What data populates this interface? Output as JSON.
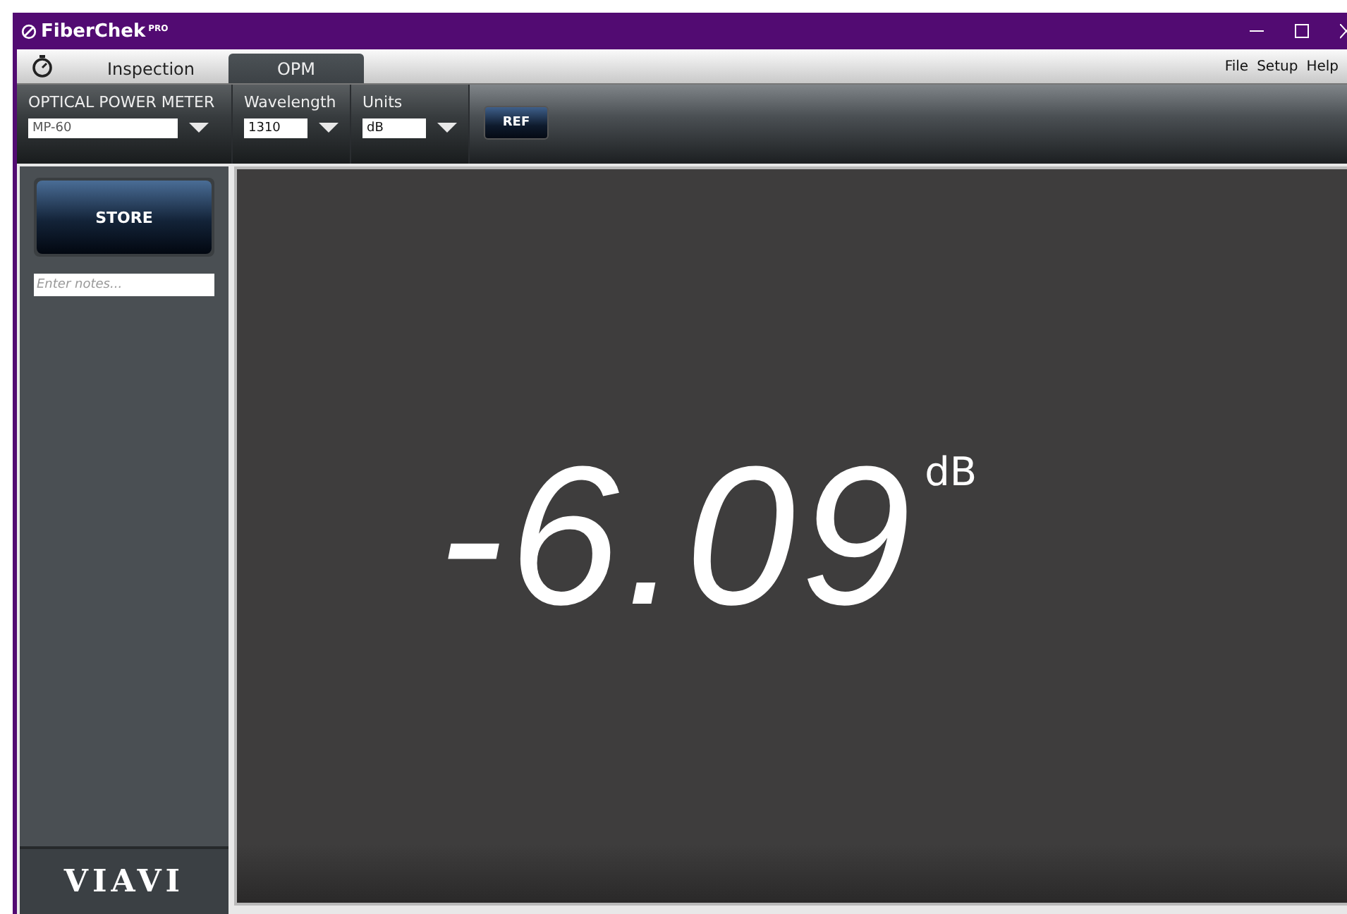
{
  "window": {
    "title": "FiberChek",
    "title_suffix": "PRO"
  },
  "tabs": [
    {
      "label": "Inspection",
      "selected": false
    },
    {
      "label": "OPM",
      "selected": true
    }
  ],
  "menu": [
    "File",
    "Setup",
    "Help"
  ],
  "toolbar": {
    "groups": [
      {
        "label": "OPTICAL POWER METER",
        "value": "MP-60"
      },
      {
        "label": "Wavelength",
        "value": "1310"
      },
      {
        "label": "Units",
        "value": "dB"
      }
    ],
    "ref_button": "REF"
  },
  "sidebar": {
    "store_button": "STORE",
    "notes": {
      "placeholder": "Enter notes..."
    },
    "logo": "VIAVI"
  },
  "display": {
    "reading": "-6.09",
    "unit": "dB"
  }
}
